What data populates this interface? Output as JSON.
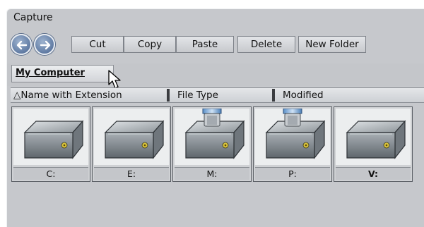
{
  "window": {
    "title": "Capture"
  },
  "navigation": {
    "back_icon": "back-arrow-icon",
    "forward_icon": "forward-arrow-icon"
  },
  "toolbar": {
    "cut": "Cut",
    "copy": "Copy",
    "paste": "Paste",
    "delete": "Delete",
    "new_folder": "New Folder"
  },
  "breadcrumb": {
    "current": "My Computer"
  },
  "columns": {
    "sort_indicator": "△",
    "name": "Name with Extension",
    "type": "File Type",
    "modified": "Modified"
  },
  "drives": [
    {
      "label": "C:",
      "icon": "hard-drive-icon"
    },
    {
      "label": "E:",
      "icon": "hard-drive-icon"
    },
    {
      "label": "M:",
      "icon": "usb-drive-icon"
    },
    {
      "label": "P:",
      "icon": "usb-drive-icon"
    },
    {
      "label": "V:",
      "icon": "hard-drive-icon"
    }
  ],
  "colors": {
    "window_bg": "#c6c8cc",
    "nav_button": "#6d87ad"
  }
}
